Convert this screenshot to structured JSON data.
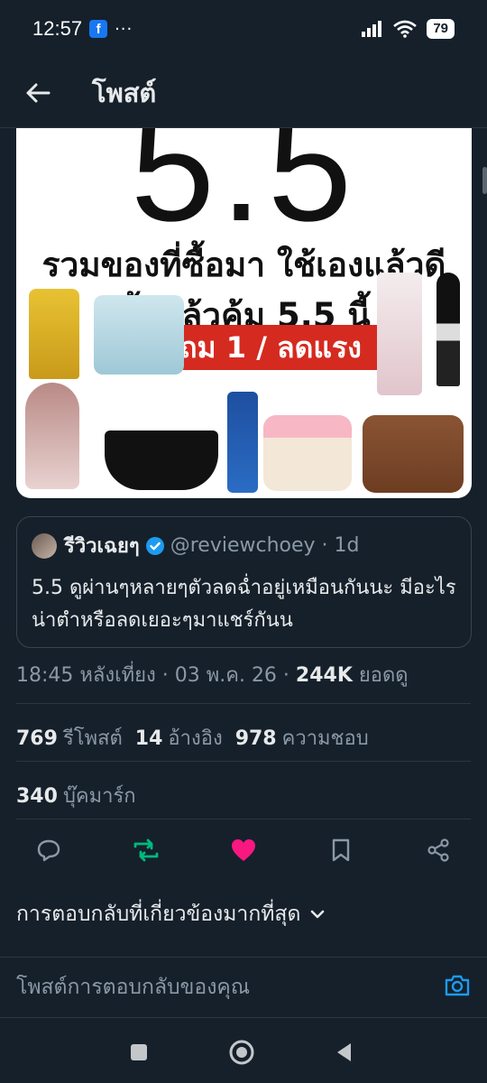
{
  "status": {
    "time": "12:57",
    "app_badge": "f",
    "dots": "···",
    "battery": "79"
  },
  "nav": {
    "title": "โพสต์"
  },
  "media": {
    "headline": "5.5",
    "line1": "รวมของที่ซื้อมา ใช้เองแล้วดี",
    "line2": "ซื้อแล้วคุ้ม 5.5 นี้",
    "promo": "1 แถม 1 / ลดแรง"
  },
  "quote": {
    "name": "รีวิวเฉยๆ",
    "handle": "@reviewchoey · 1d",
    "text": "5.5 ดูผ่านๆหลายๆตัวลดฉ่ำอยู่เหมือนกันนะ มีอะไรน่าตำหรือลดเยอะๆมาแชร์กันน"
  },
  "meta": {
    "time": "18:45 หลังเที่ยง · 03 พ.ค. 26 · ",
    "views_count": "244K",
    "views_label": "ยอดดู"
  },
  "stats": {
    "reposts_count": "769",
    "reposts_label": "รีโพสต์",
    "quotes_count": "14",
    "quotes_label": "อ้างอิง",
    "likes_count": "978",
    "likes_label": "ความชอบ",
    "bookmarks_count": "340",
    "bookmarks_label": "บุ๊คมาร์ก"
  },
  "actions": {
    "reply": "reply-icon",
    "repost": "repost-icon",
    "like": "heart-icon",
    "bookmark": "bookmark-icon",
    "share": "share-icon"
  },
  "colors": {
    "background": "#15202b",
    "repost_active": "#00ba7c",
    "like_active": "#f91880",
    "link": "#1d9bf0"
  },
  "replies": {
    "sort_label": "การตอบกลับที่เกี่ยวข้องมากที่สุด"
  },
  "reply_bar": {
    "placeholder": "โพสต์การตอบกลับของคุณ"
  }
}
